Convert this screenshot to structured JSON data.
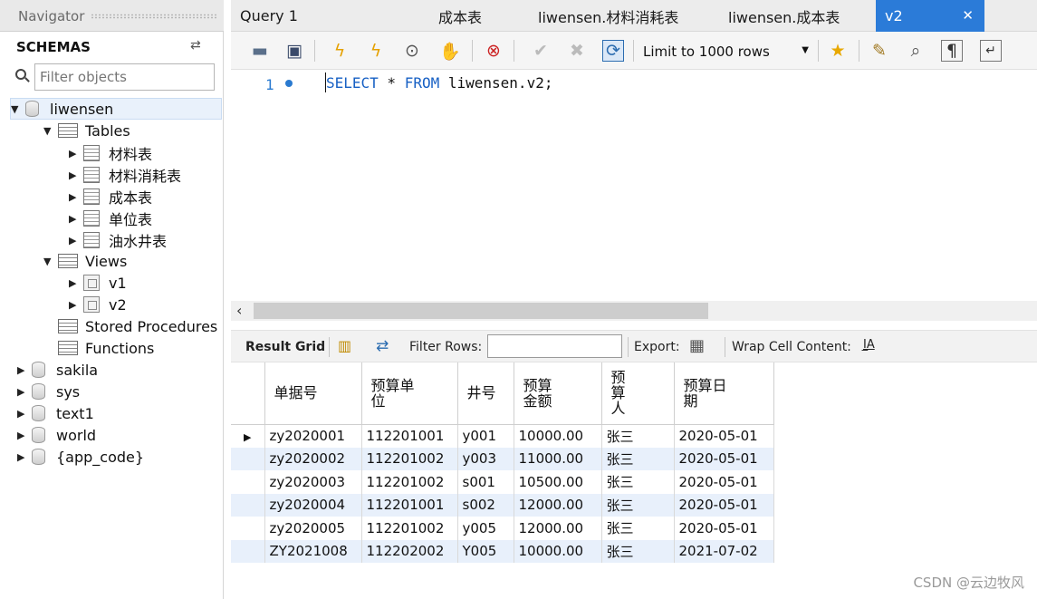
{
  "navigator": {
    "title": "Navigator",
    "schemas_title": "SCHEMAS",
    "filter_placeholder": "Filter objects",
    "tree": {
      "db_liwensen": "liwensen",
      "tables_label": "Tables",
      "tables": [
        "材料表",
        "材料消耗表",
        "成本表",
        "单位表",
        "油水井表"
      ],
      "views_label": "Views",
      "views": [
        "v1",
        "v2"
      ],
      "stored_procedures": "Stored Procedures",
      "functions": "Functions",
      "other_dbs": [
        "sakila",
        "sys",
        "text1",
        "world",
        "{app_code}"
      ]
    }
  },
  "tabs": [
    "Query 1",
    "成本表",
    "liwensen.材料消耗表",
    "liwensen.成本表",
    "v2"
  ],
  "toolbar": {
    "limit_label": "Limit to 1000 rows",
    "icons": [
      "open-folder-icon",
      "save-icon",
      "execute-icon",
      "execute-current-icon",
      "explain-icon",
      "stop-icon",
      "toggle-error-icon",
      "commit-icon",
      "rollback-icon",
      "autocommit-icon",
      "bookmark-icon",
      "beautify-icon",
      "find-icon",
      "invisible-chars-icon",
      "wrap-icon"
    ]
  },
  "editor": {
    "line_number": "1",
    "sql_keyword1": "SELECT",
    "sql_star": " * ",
    "sql_keyword2": "FROM",
    "sql_rest": " liwensen.v2;"
  },
  "result_toolbar": {
    "result_grid": "Result Grid",
    "filter_rows": "Filter Rows:",
    "export": "Export:",
    "wrap_cell": "Wrap Cell Content:"
  },
  "grid": {
    "columns": [
      "单据号",
      "预算单\n位",
      "井号",
      "预算\n金额",
      "预\n算\n人",
      "预算日\n期"
    ],
    "rows": [
      [
        "zy2020001",
        "112201001",
        "y001",
        "10000.00",
        "张三",
        "2020-05-01"
      ],
      [
        "zy2020002",
        "112201002",
        "y003",
        "11000.00",
        "张三",
        "2020-05-01"
      ],
      [
        "zy2020003",
        "112201002",
        "s001",
        "10500.00",
        "张三",
        "2020-05-01"
      ],
      [
        "zy2020004",
        "112201001",
        "s002",
        "12000.00",
        "张三",
        "2020-05-01"
      ],
      [
        "zy2020005",
        "112201002",
        "y005",
        "12000.00",
        "张三",
        "2020-05-01"
      ],
      [
        "ZY2021008",
        "112202002",
        "Y005",
        "10000.00",
        "张三",
        "2021-07-02"
      ]
    ]
  },
  "watermark": "CSDN @云边牧风"
}
